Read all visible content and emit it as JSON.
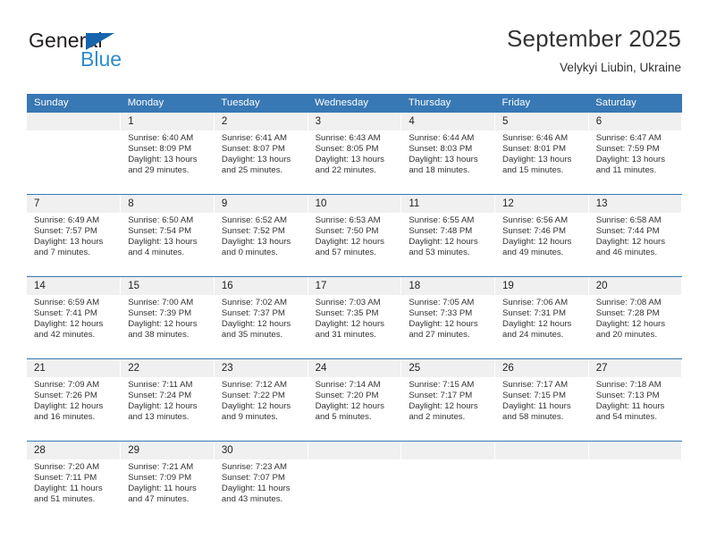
{
  "brand": {
    "name_dark": "General",
    "name_blue": "Blue",
    "accent_dark_blue": "#1565ad",
    "accent_light_blue": "#2e8bd0"
  },
  "header": {
    "title": "September 2025",
    "subtitle": "Velykyi Liubin, Ukraine"
  },
  "theme": {
    "header_bar": "#3878b4",
    "daynum_band": "#f0f0f0",
    "text": "#333333"
  },
  "weekdays": [
    "Sunday",
    "Monday",
    "Tuesday",
    "Wednesday",
    "Thursday",
    "Friday",
    "Saturday"
  ],
  "weeks": [
    [
      {
        "day": "",
        "sunrise": "",
        "sunset": "",
        "daylight1": "",
        "daylight2": ""
      },
      {
        "day": "1",
        "sunrise": "Sunrise: 6:40 AM",
        "sunset": "Sunset: 8:09 PM",
        "daylight1": "Daylight: 13 hours",
        "daylight2": "and 29 minutes."
      },
      {
        "day": "2",
        "sunrise": "Sunrise: 6:41 AM",
        "sunset": "Sunset: 8:07 PM",
        "daylight1": "Daylight: 13 hours",
        "daylight2": "and 25 minutes."
      },
      {
        "day": "3",
        "sunrise": "Sunrise: 6:43 AM",
        "sunset": "Sunset: 8:05 PM",
        "daylight1": "Daylight: 13 hours",
        "daylight2": "and 22 minutes."
      },
      {
        "day": "4",
        "sunrise": "Sunrise: 6:44 AM",
        "sunset": "Sunset: 8:03 PM",
        "daylight1": "Daylight: 13 hours",
        "daylight2": "and 18 minutes."
      },
      {
        "day": "5",
        "sunrise": "Sunrise: 6:46 AM",
        "sunset": "Sunset: 8:01 PM",
        "daylight1": "Daylight: 13 hours",
        "daylight2": "and 15 minutes."
      },
      {
        "day": "6",
        "sunrise": "Sunrise: 6:47 AM",
        "sunset": "Sunset: 7:59 PM",
        "daylight1": "Daylight: 13 hours",
        "daylight2": "and 11 minutes."
      }
    ],
    [
      {
        "day": "7",
        "sunrise": "Sunrise: 6:49 AM",
        "sunset": "Sunset: 7:57 PM",
        "daylight1": "Daylight: 13 hours",
        "daylight2": "and 7 minutes."
      },
      {
        "day": "8",
        "sunrise": "Sunrise: 6:50 AM",
        "sunset": "Sunset: 7:54 PM",
        "daylight1": "Daylight: 13 hours",
        "daylight2": "and 4 minutes."
      },
      {
        "day": "9",
        "sunrise": "Sunrise: 6:52 AM",
        "sunset": "Sunset: 7:52 PM",
        "daylight1": "Daylight: 13 hours",
        "daylight2": "and 0 minutes."
      },
      {
        "day": "10",
        "sunrise": "Sunrise: 6:53 AM",
        "sunset": "Sunset: 7:50 PM",
        "daylight1": "Daylight: 12 hours",
        "daylight2": "and 57 minutes."
      },
      {
        "day": "11",
        "sunrise": "Sunrise: 6:55 AM",
        "sunset": "Sunset: 7:48 PM",
        "daylight1": "Daylight: 12 hours",
        "daylight2": "and 53 minutes."
      },
      {
        "day": "12",
        "sunrise": "Sunrise: 6:56 AM",
        "sunset": "Sunset: 7:46 PM",
        "daylight1": "Daylight: 12 hours",
        "daylight2": "and 49 minutes."
      },
      {
        "day": "13",
        "sunrise": "Sunrise: 6:58 AM",
        "sunset": "Sunset: 7:44 PM",
        "daylight1": "Daylight: 12 hours",
        "daylight2": "and 46 minutes."
      }
    ],
    [
      {
        "day": "14",
        "sunrise": "Sunrise: 6:59 AM",
        "sunset": "Sunset: 7:41 PM",
        "daylight1": "Daylight: 12 hours",
        "daylight2": "and 42 minutes."
      },
      {
        "day": "15",
        "sunrise": "Sunrise: 7:00 AM",
        "sunset": "Sunset: 7:39 PM",
        "daylight1": "Daylight: 12 hours",
        "daylight2": "and 38 minutes."
      },
      {
        "day": "16",
        "sunrise": "Sunrise: 7:02 AM",
        "sunset": "Sunset: 7:37 PM",
        "daylight1": "Daylight: 12 hours",
        "daylight2": "and 35 minutes."
      },
      {
        "day": "17",
        "sunrise": "Sunrise: 7:03 AM",
        "sunset": "Sunset: 7:35 PM",
        "daylight1": "Daylight: 12 hours",
        "daylight2": "and 31 minutes."
      },
      {
        "day": "18",
        "sunrise": "Sunrise: 7:05 AM",
        "sunset": "Sunset: 7:33 PM",
        "daylight1": "Daylight: 12 hours",
        "daylight2": "and 27 minutes."
      },
      {
        "day": "19",
        "sunrise": "Sunrise: 7:06 AM",
        "sunset": "Sunset: 7:31 PM",
        "daylight1": "Daylight: 12 hours",
        "daylight2": "and 24 minutes."
      },
      {
        "day": "20",
        "sunrise": "Sunrise: 7:08 AM",
        "sunset": "Sunset: 7:28 PM",
        "daylight1": "Daylight: 12 hours",
        "daylight2": "and 20 minutes."
      }
    ],
    [
      {
        "day": "21",
        "sunrise": "Sunrise: 7:09 AM",
        "sunset": "Sunset: 7:26 PM",
        "daylight1": "Daylight: 12 hours",
        "daylight2": "and 16 minutes."
      },
      {
        "day": "22",
        "sunrise": "Sunrise: 7:11 AM",
        "sunset": "Sunset: 7:24 PM",
        "daylight1": "Daylight: 12 hours",
        "daylight2": "and 13 minutes."
      },
      {
        "day": "23",
        "sunrise": "Sunrise: 7:12 AM",
        "sunset": "Sunset: 7:22 PM",
        "daylight1": "Daylight: 12 hours",
        "daylight2": "and 9 minutes."
      },
      {
        "day": "24",
        "sunrise": "Sunrise: 7:14 AM",
        "sunset": "Sunset: 7:20 PM",
        "daylight1": "Daylight: 12 hours",
        "daylight2": "and 5 minutes."
      },
      {
        "day": "25",
        "sunrise": "Sunrise: 7:15 AM",
        "sunset": "Sunset: 7:17 PM",
        "daylight1": "Daylight: 12 hours",
        "daylight2": "and 2 minutes."
      },
      {
        "day": "26",
        "sunrise": "Sunrise: 7:17 AM",
        "sunset": "Sunset: 7:15 PM",
        "daylight1": "Daylight: 11 hours",
        "daylight2": "and 58 minutes."
      },
      {
        "day": "27",
        "sunrise": "Sunrise: 7:18 AM",
        "sunset": "Sunset: 7:13 PM",
        "daylight1": "Daylight: 11 hours",
        "daylight2": "and 54 minutes."
      }
    ],
    [
      {
        "day": "28",
        "sunrise": "Sunrise: 7:20 AM",
        "sunset": "Sunset: 7:11 PM",
        "daylight1": "Daylight: 11 hours",
        "daylight2": "and 51 minutes."
      },
      {
        "day": "29",
        "sunrise": "Sunrise: 7:21 AM",
        "sunset": "Sunset: 7:09 PM",
        "daylight1": "Daylight: 11 hours",
        "daylight2": "and 47 minutes."
      },
      {
        "day": "30",
        "sunrise": "Sunrise: 7:23 AM",
        "sunset": "Sunset: 7:07 PM",
        "daylight1": "Daylight: 11 hours",
        "daylight2": "and 43 minutes."
      },
      {
        "day": "",
        "sunrise": "",
        "sunset": "",
        "daylight1": "",
        "daylight2": ""
      },
      {
        "day": "",
        "sunrise": "",
        "sunset": "",
        "daylight1": "",
        "daylight2": ""
      },
      {
        "day": "",
        "sunrise": "",
        "sunset": "",
        "daylight1": "",
        "daylight2": ""
      },
      {
        "day": "",
        "sunrise": "",
        "sunset": "",
        "daylight1": "",
        "daylight2": ""
      }
    ]
  ]
}
